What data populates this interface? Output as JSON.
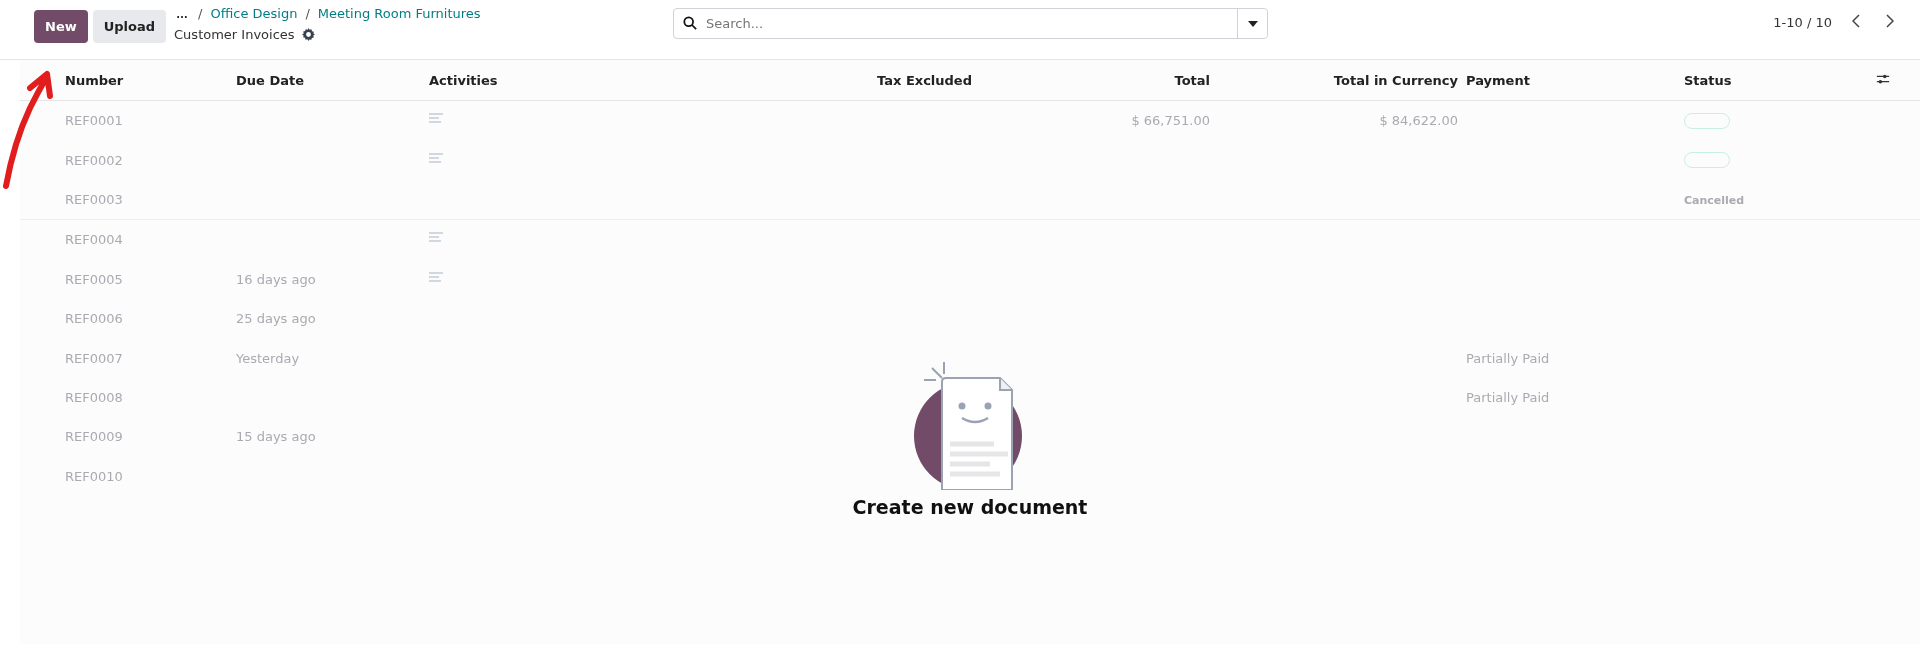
{
  "control_panel": {
    "buttons": [
      {
        "label": "New",
        "kind": "primary"
      },
      {
        "label": "Upload",
        "kind": "secondary"
      }
    ],
    "breadcrumbs": [
      {
        "kind": "more",
        "label": "…"
      },
      {
        "kind": "separator",
        "label": "/"
      },
      {
        "kind": "link",
        "label": "Office Design"
      },
      {
        "kind": "separator",
        "label": "/"
      },
      {
        "kind": "link",
        "label": "Meeting Room Furnitures"
      }
    ],
    "title": "Customer Invoices",
    "search": {
      "placeholder": "Search..."
    },
    "pager": "1-10 / 10"
  },
  "table": {
    "columns": [
      "Number",
      "Due Date",
      "Activities",
      "Tax Excluded",
      "Total",
      "Total in Currency",
      "Payment",
      "Status"
    ],
    "rows": [
      {
        "number": "REF0001",
        "activity_icon": true,
        "total": "$ 66,751.00",
        "total_currency": "$ 84,622.00",
        "status": {
          "kind": "badge"
        }
      },
      {
        "number": "REF0002",
        "activity_icon": true,
        "status": {
          "kind": "badge"
        }
      },
      {
        "number": "REF0003",
        "status": {
          "kind": "text",
          "label": "Cancelled"
        }
      },
      {
        "number": "REF0004",
        "activity_icon": true
      },
      {
        "number": "REF0005",
        "due_date": "16 days ago",
        "activity_icon": true
      },
      {
        "number": "REF0006",
        "due_date": "25 days ago"
      },
      {
        "number": "REF0007",
        "due_date": "Yesterday",
        "payment": "Partially Paid"
      },
      {
        "number": "REF0008",
        "payment": "Partially Paid"
      },
      {
        "number": "REF0009",
        "due_date": "15 days ago"
      },
      {
        "number": "REF0010"
      }
    ]
  },
  "empty_state": {
    "title": "Create new document"
  }
}
